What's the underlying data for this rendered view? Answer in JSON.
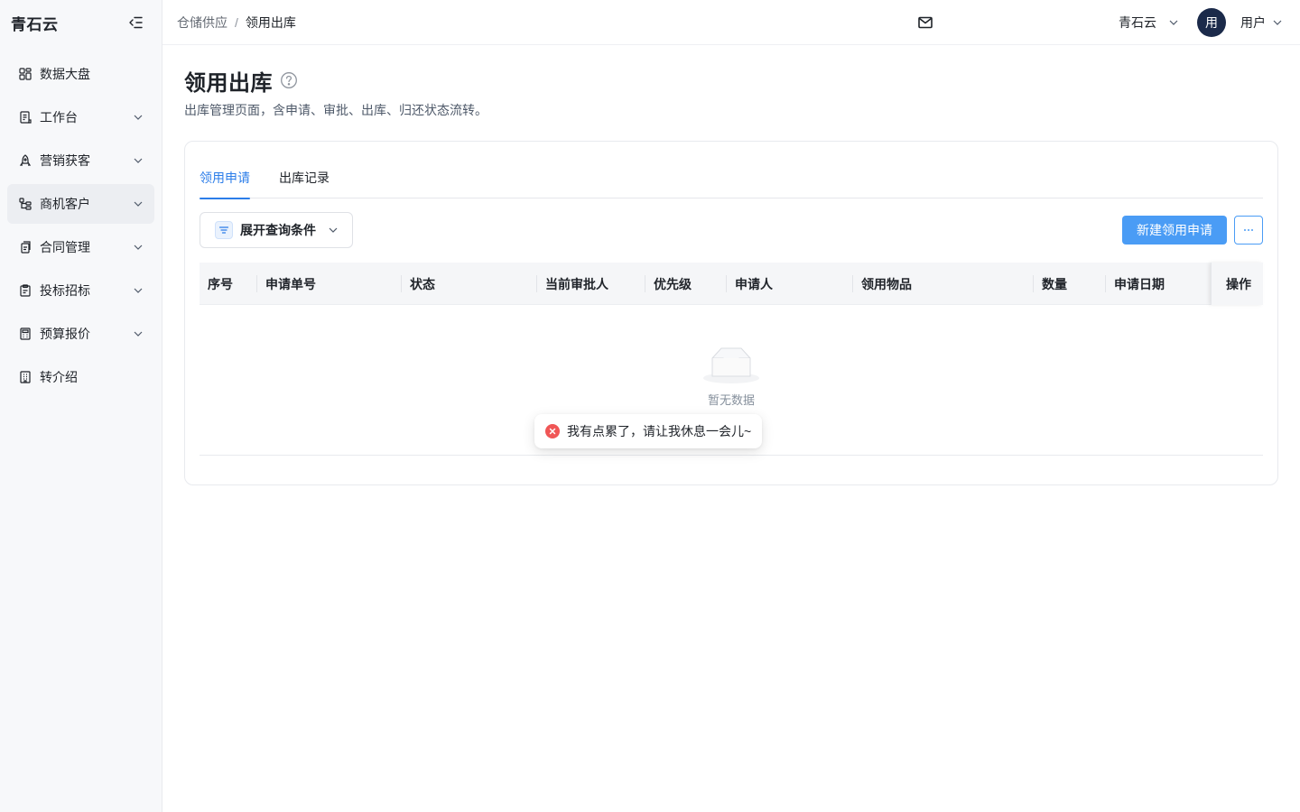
{
  "sidebar": {
    "brand": "青石云",
    "items": [
      {
        "label": "数据大盘",
        "icon": "dashboard-icon",
        "has_children": false,
        "active": false
      },
      {
        "label": "工作台",
        "icon": "workbench-icon",
        "has_children": true,
        "active": false
      },
      {
        "label": "营销获客",
        "icon": "rocket-icon",
        "has_children": true,
        "active": false
      },
      {
        "label": "商机客户",
        "icon": "org-tree-icon",
        "has_children": true,
        "active": true
      },
      {
        "label": "合同管理",
        "icon": "documents-icon",
        "has_children": true,
        "active": false
      },
      {
        "label": "投标招标",
        "icon": "clipboard-icon",
        "has_children": true,
        "active": false
      },
      {
        "label": "预算报价",
        "icon": "calculator-icon",
        "has_children": true,
        "active": false
      },
      {
        "label": "转介绍",
        "icon": "building-icon",
        "has_children": false,
        "active": false
      }
    ]
  },
  "header": {
    "breadcrumb": {
      "parent": "仓储供应",
      "separator": "/",
      "current": "领用出库"
    },
    "org": "青石云",
    "avatar_text": "用",
    "user": "用户"
  },
  "page": {
    "title": "领用出库",
    "description": "出库管理页面，含申请、审批、出库、归还状态流转。"
  },
  "tabs": [
    {
      "label": "领用申请",
      "active": true
    },
    {
      "label": "出库记录",
      "active": false
    }
  ],
  "toolbar": {
    "filter_label": "展开查询条件",
    "create_label": "新建领用申请",
    "more_label": "···"
  },
  "table": {
    "columns": [
      "序号",
      "申请单号",
      "状态",
      "当前审批人",
      "优先级",
      "申请人",
      "领用物品",
      "数量",
      "申请日期"
    ],
    "fixed_column": "操作",
    "empty_text": "暂无数据"
  },
  "toast": {
    "type": "error",
    "message": "我有点累了，请让我休息一会儿~"
  },
  "colors": {
    "primary": "#4a9cf5",
    "tab_active": "#2b7de9",
    "avatar_bg": "#1b2a4a",
    "error": "#f05656"
  }
}
